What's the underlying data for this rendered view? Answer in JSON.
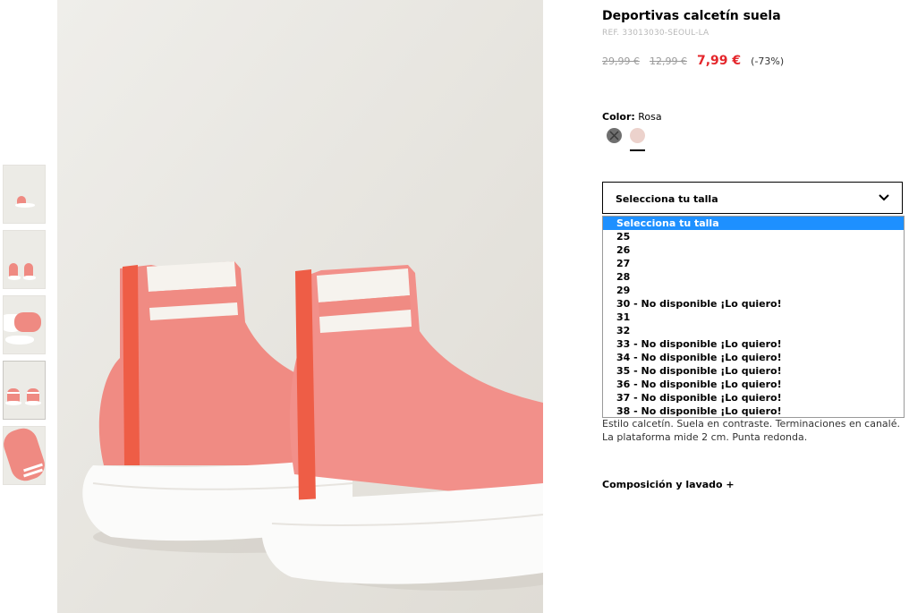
{
  "product": {
    "title": "Deportivas calcetín suela",
    "ref": "REF. 33013030-SEOUL-LA",
    "price_original": "29,99 €",
    "price_previous": "12,99 €",
    "price_current": "7,99 €",
    "discount": "(-73%)"
  },
  "color": {
    "label": "Color:",
    "value": "Rosa",
    "swatches": [
      "grey",
      "pink"
    ],
    "selected": "pink"
  },
  "size_select": {
    "label": "Selecciona tu talla",
    "options": [
      "Selecciona tu talla",
      "25",
      "26",
      "27",
      "28",
      "29",
      "30 - No disponible ¡Lo quiero!",
      "31",
      "32",
      "33 - No disponible ¡Lo quiero!",
      "34 - No disponible ¡Lo quiero!",
      "35 - No disponible ¡Lo quiero!",
      "36 - No disponible ¡Lo quiero!",
      "37 - No disponible ¡Lo quiero!",
      "38 - No disponible ¡Lo quiero!"
    ],
    "selected_index": 0
  },
  "description": {
    "line1": "Estilo calcetín. Suela en contraste. Terminaciones en canalé.",
    "line2": "La plataforma mide 2 cm. Punta redonda."
  },
  "composition_label": "Composición y lavado +",
  "colors": {
    "price_red": "#e4262b",
    "highlight_blue": "#1e90ff",
    "shoe_coral": "#ef8a82",
    "background_beige": "#ecebe6"
  }
}
